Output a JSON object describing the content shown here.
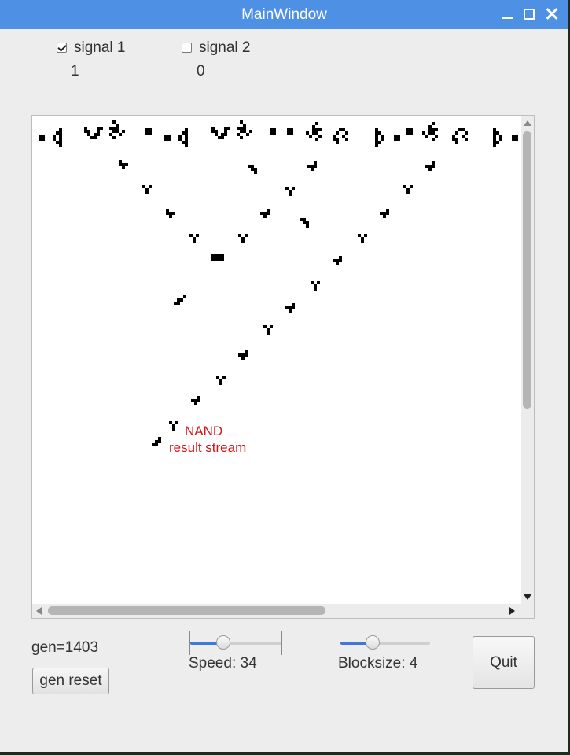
{
  "window": {
    "title": "MainWindow"
  },
  "signals": [
    {
      "label": "signal 1",
      "checked": true,
      "value": "1"
    },
    {
      "label": "signal 2",
      "checked": false,
      "value": "0"
    }
  ],
  "canvas": {
    "annotation_lines": [
      "NAND",
      "result stream"
    ],
    "annotation_color": "#d81414",
    "cell_color": "#000000"
  },
  "controls": {
    "gen_label": "gen=1403",
    "gen_reset_label": "gen reset",
    "speed": {
      "label": "Speed: 34",
      "value": 34,
      "fraction": 0.36
    },
    "blocksize": {
      "label": "Blocksize: 4",
      "value": 4,
      "fraction": 0.36
    },
    "quit_label": "Quit"
  },
  "colors": {
    "titlebar": "#4e90e4",
    "slider_fill": "#3d7ad8",
    "background": "#ededed"
  }
}
